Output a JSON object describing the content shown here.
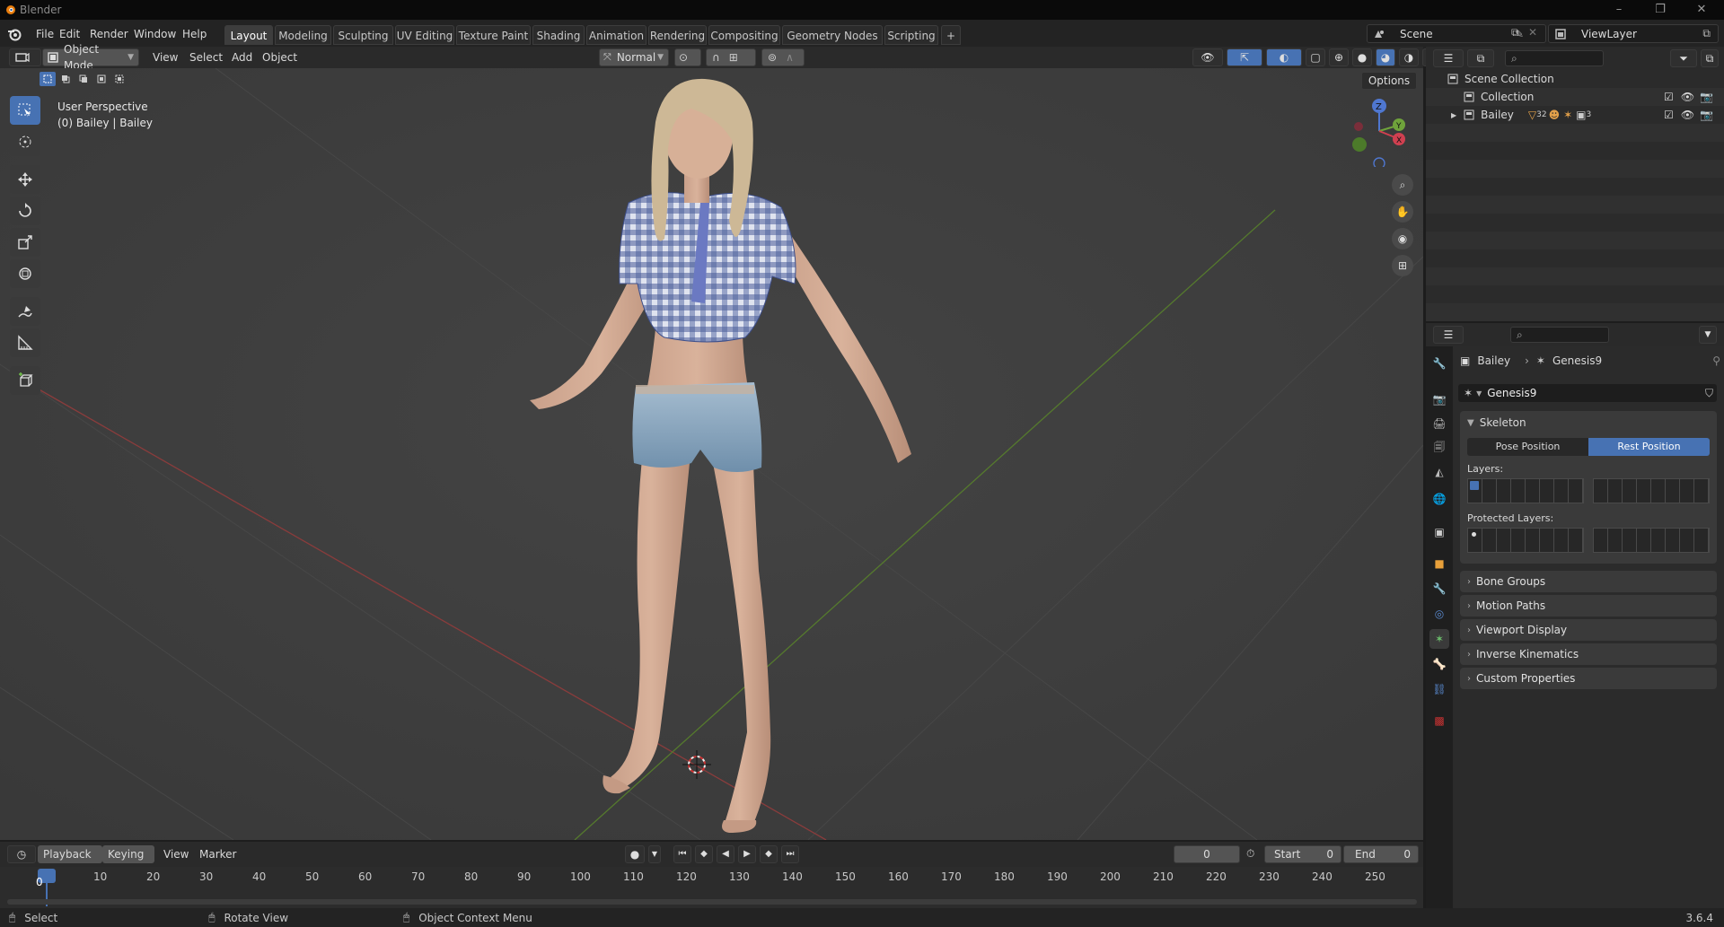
{
  "window": {
    "title": "Blender",
    "version": "3.6.4"
  },
  "menus": [
    "File",
    "Edit",
    "Render",
    "Window",
    "Help"
  ],
  "workspaces": [
    "Layout",
    "Modeling",
    "Sculpting",
    "UV Editing",
    "Texture Paint",
    "Shading",
    "Animation",
    "Rendering",
    "Compositing",
    "Geometry Nodes",
    "Scripting"
  ],
  "active_workspace": "Layout",
  "scene": {
    "name": "Scene",
    "view_layer": "ViewLayer"
  },
  "viewport": {
    "mode": "Object Mode",
    "menus": [
      "View",
      "Select",
      "Add",
      "Object"
    ],
    "orientation": "Normal",
    "options_label": "Options",
    "info_line1": "User Perspective",
    "info_line2": "(0) Bailey | Bailey",
    "gizmo_axes": [
      "Z",
      "Y",
      "X"
    ]
  },
  "outliner": {
    "root": "Scene Collection",
    "items": [
      {
        "label": "Collection"
      },
      {
        "label": "Bailey",
        "badges": [
          "32",
          "3"
        ]
      }
    ]
  },
  "properties": {
    "breadcrumb_object": "Bailey",
    "breadcrumb_data": "Genesis9",
    "data_name": "Genesis9",
    "skeleton_label": "Skeleton",
    "pose_position": "Pose Position",
    "rest_position": "Rest Position",
    "layers_label": "Layers:",
    "protected_layers_label": "Protected Layers:",
    "panels": [
      "Bone Groups",
      "Motion Paths",
      "Viewport Display",
      "Inverse Kinematics",
      "Custom Properties"
    ]
  },
  "timeline": {
    "menus": [
      "Playback",
      "Keying",
      "View",
      "Marker"
    ],
    "current_frame": "0",
    "start_label": "Start",
    "start_value": "0",
    "end_label": "End",
    "end_value": "0",
    "ticks": [
      "0",
      "10",
      "20",
      "30",
      "40",
      "50",
      "60",
      "70",
      "80",
      "90",
      "100",
      "110",
      "120",
      "130",
      "140",
      "150",
      "160",
      "170",
      "180",
      "190",
      "200",
      "210",
      "220",
      "230",
      "240",
      "250"
    ]
  },
  "status": {
    "select": "Select",
    "rotate": "Rotate View",
    "context": "Object Context Menu"
  },
  "colors": {
    "accent": "#4772b3",
    "orange": "#e87d0d",
    "x_axis": "#aa3a3a",
    "y_axis": "#5d8a2a"
  }
}
